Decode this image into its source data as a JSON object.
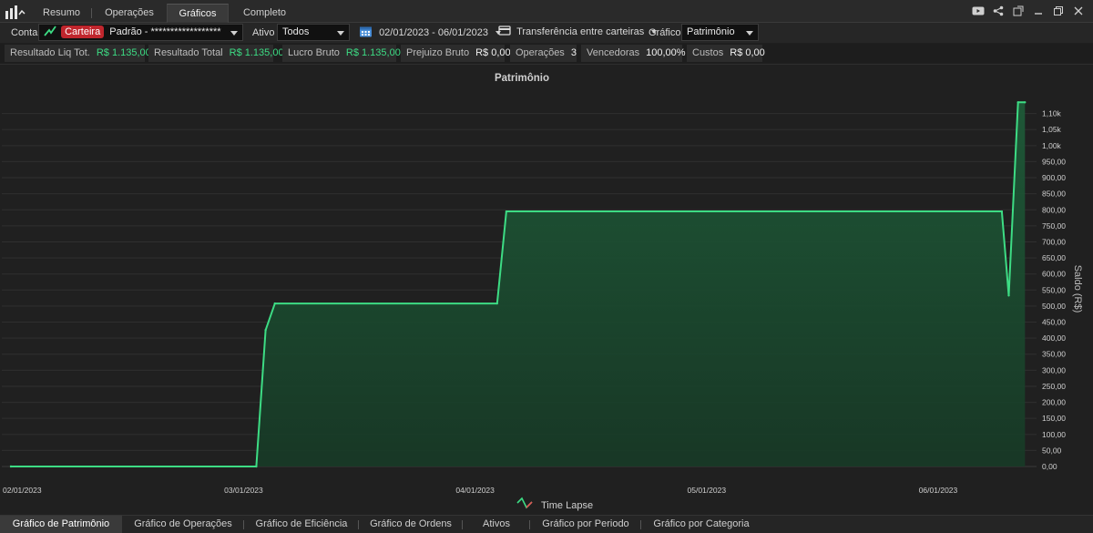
{
  "tabs": [
    {
      "label": "Resumo"
    },
    {
      "label": "Operações"
    },
    {
      "label": "Gráficos"
    },
    {
      "label": "Completo"
    }
  ],
  "toolbar": {
    "conta_label": "Conta",
    "carteira_badge": "Carteira",
    "account_value": "Padrão - ******************",
    "ativo_label": "Ativo",
    "ativo_value": "Todos",
    "date_range": "02/01/2023 - 06/01/2023",
    "transfer_label": "Transferência entre carteiras",
    "grafico_label": "Gráfico",
    "grafico_value": "Patrimônio"
  },
  "stats": [
    {
      "label": "Resultado Liq Tot.",
      "value": "R$ 1.135,00",
      "positive": true
    },
    {
      "label": "Resultado Total",
      "value": "R$ 1.135,00",
      "positive": true
    },
    {
      "label": "Lucro Bruto",
      "value": "R$ 1.135,00",
      "positive": true
    },
    {
      "label": "Prejuizo Bruto",
      "value": "R$ 0,00",
      "positive": false
    },
    {
      "label": "Operações",
      "value": "3",
      "positive": false
    },
    {
      "label": "Vencedoras",
      "value": "100,00%",
      "positive": false
    },
    {
      "label": "Custos",
      "value": "R$ 0,00",
      "positive": false
    }
  ],
  "chart_data": {
    "type": "area",
    "title": "Patrimônio",
    "ylabel": "Saldo (R$)",
    "ylim": [
      0,
      1150
    ],
    "yticks": [
      0,
      50,
      100,
      150,
      200,
      250,
      300,
      350,
      400,
      450,
      500,
      550,
      600,
      650,
      700,
      750,
      800,
      850,
      900,
      950,
      1000,
      1050,
      1100
    ],
    "ytick_labels": [
      "0,00",
      "50,00",
      "100,00",
      "150,00",
      "200,00",
      "250,00",
      "300,00",
      "350,00",
      "400,00",
      "450,00",
      "500,00",
      "550,00",
      "600,00",
      "650,00",
      "700,00",
      "750,00",
      "800,00",
      "850,00",
      "900,00",
      "950,00",
      "1,00k",
      "1,05k",
      "1,10k"
    ],
    "xlim": [
      0,
      4.43
    ],
    "xticks": [
      0,
      1,
      2,
      3,
      4
    ],
    "xtick_labels": [
      "02/01/2023",
      "03/01/2023",
      "04/01/2023",
      "05/01/2023",
      "06/01/2023"
    ],
    "series": [
      {
        "x": [
          0,
          1.06,
          1.1,
          1.14,
          2.1,
          2.14,
          4.28,
          4.31,
          4.35,
          4.38
        ],
        "y": [
          0,
          0,
          425,
          508,
          508,
          795,
          795,
          533,
          1135,
          1135
        ]
      }
    ],
    "legend": [
      {
        "label": "Time Lapse",
        "position": "bottom-center"
      }
    ],
    "colors": {
      "line": "#3ddc84",
      "fill": "#1e5a38"
    }
  },
  "bottom_tabs": [
    {
      "label": "Gráfico de Patrimônio"
    },
    {
      "label": "Gráfico de Operações"
    },
    {
      "label": "Gráfico de Eficiência"
    },
    {
      "label": "Gráfico de Ordens"
    },
    {
      "label": "Ativos"
    },
    {
      "label": "Gráfico por Periodo"
    },
    {
      "label": "Gráfico por Categoria"
    }
  ]
}
